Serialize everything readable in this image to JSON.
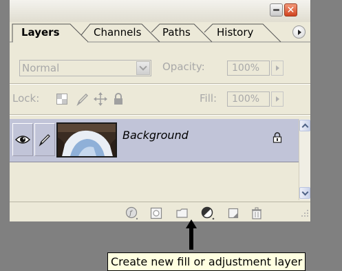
{
  "tabs": [
    {
      "label": "Layers",
      "active": true
    },
    {
      "label": "Channels",
      "active": false
    },
    {
      "label": "Paths",
      "active": false
    },
    {
      "label": "History",
      "active": false
    }
  ],
  "blend_mode": {
    "selected": "Normal"
  },
  "opacity": {
    "label": "Opacity:",
    "value": "100%"
  },
  "lock": {
    "label": "Lock:"
  },
  "fill": {
    "label": "Fill:",
    "value": "100%"
  },
  "layers": [
    {
      "name": "Background",
      "visible": true,
      "locked": true
    }
  ],
  "tooltip": {
    "text": "Create new fill or adjustment layer"
  },
  "colors": {
    "panel_bg": "#ece9d8",
    "selected_layer_bg": "#c1c4d8",
    "tooltip_bg": "#ffffe1",
    "close_button": "#d0421f",
    "desktop_bg": "#808080"
  },
  "icons": {
    "title_buttons": [
      "minimize-icon",
      "close-icon"
    ],
    "panel_menu": "flyout-menu-icon",
    "lock_options": [
      "lock-transparent-pixels-icon",
      "lock-image-pixels-icon",
      "lock-position-icon",
      "lock-all-icon"
    ],
    "bottom_bar": [
      "layer-style-icon",
      "layer-mask-icon",
      "new-group-icon",
      "fill-adjustment-icon",
      "new-layer-icon",
      "trash-icon"
    ]
  }
}
